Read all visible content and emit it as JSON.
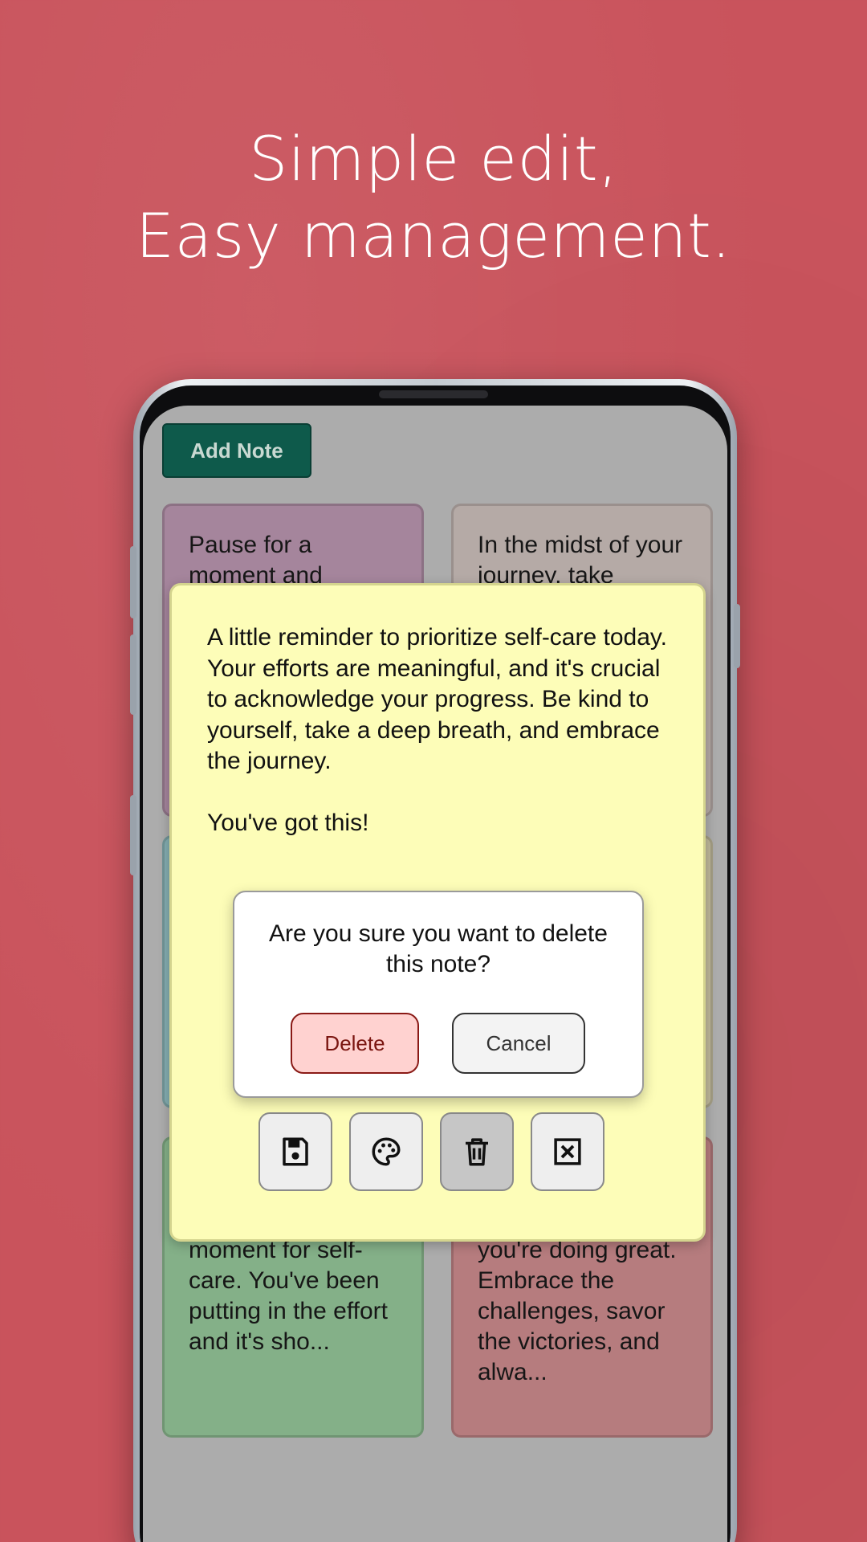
{
  "headline": {
    "line1": "Simple edit,",
    "line2": "Easy management."
  },
  "app": {
    "add_note_label": "Add Note",
    "notes": [
      {
        "text": "Pause for a moment and",
        "color": "#a5859c"
      },
      {
        "text": "In the midst of your journey, take",
        "color": "#b5aaa6"
      },
      {
        "text": "",
        "color": "#84aeb1"
      },
      {
        "text": "",
        "color": "#bfb89b"
      },
      {
        "text": "moment for self-care. You've been putting in the effort and it's sho...",
        "color": "#84b088"
      },
      {
        "text": "you're doing great. Embrace the challenges, savor the victories, and alwa...",
        "color": "#b67c7e"
      }
    ],
    "editor": {
      "text": "A little reminder to prioritize self-care today. Your efforts are meaningful, and it's crucial to acknowledge your progress. Be kind to yourself, take a deep breath, and embrace the journey.\n\nYou've got this!",
      "background": "#fdfdb8",
      "tools": [
        "save-icon",
        "palette-icon",
        "trash-icon",
        "close-box-icon"
      ]
    },
    "dialog": {
      "message": "Are you sure you want to delete this note?",
      "delete_label": "Delete",
      "cancel_label": "Cancel"
    }
  }
}
